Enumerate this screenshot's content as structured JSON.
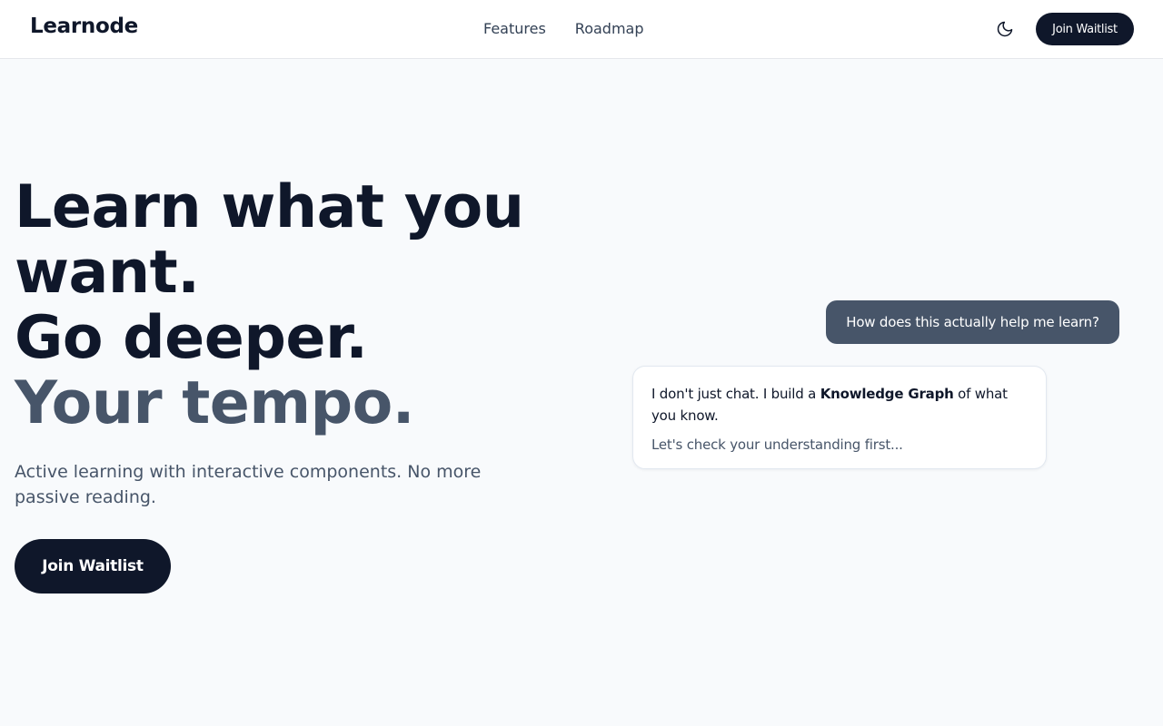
{
  "nav": {
    "brand": "Learnode",
    "links": [
      {
        "label": "Features"
      },
      {
        "label": "Roadmap"
      }
    ],
    "theme_toggle_icon": "moon-icon",
    "cta_label": "Join Waitlist"
  },
  "hero": {
    "title_lines": [
      "Learn what you",
      "want.",
      "Go deeper."
    ],
    "title_accent": "Your tempo.",
    "subtitle": "Active learning with interactive components. No more passive reading.",
    "cta_label": "Join Waitlist"
  },
  "chat": {
    "user_message": "How does this actually help me learn?",
    "ai_message_before": "I don't just chat. I build a ",
    "ai_message_bold": "Knowledge Graph",
    "ai_message_after": " of what you know.",
    "ai_followup": "Let's check your understanding first..."
  },
  "colors": {
    "primary": "#0f172a",
    "accent_text": "#475569",
    "background": "#f8fafc",
    "user_bubble": "#475569"
  }
}
